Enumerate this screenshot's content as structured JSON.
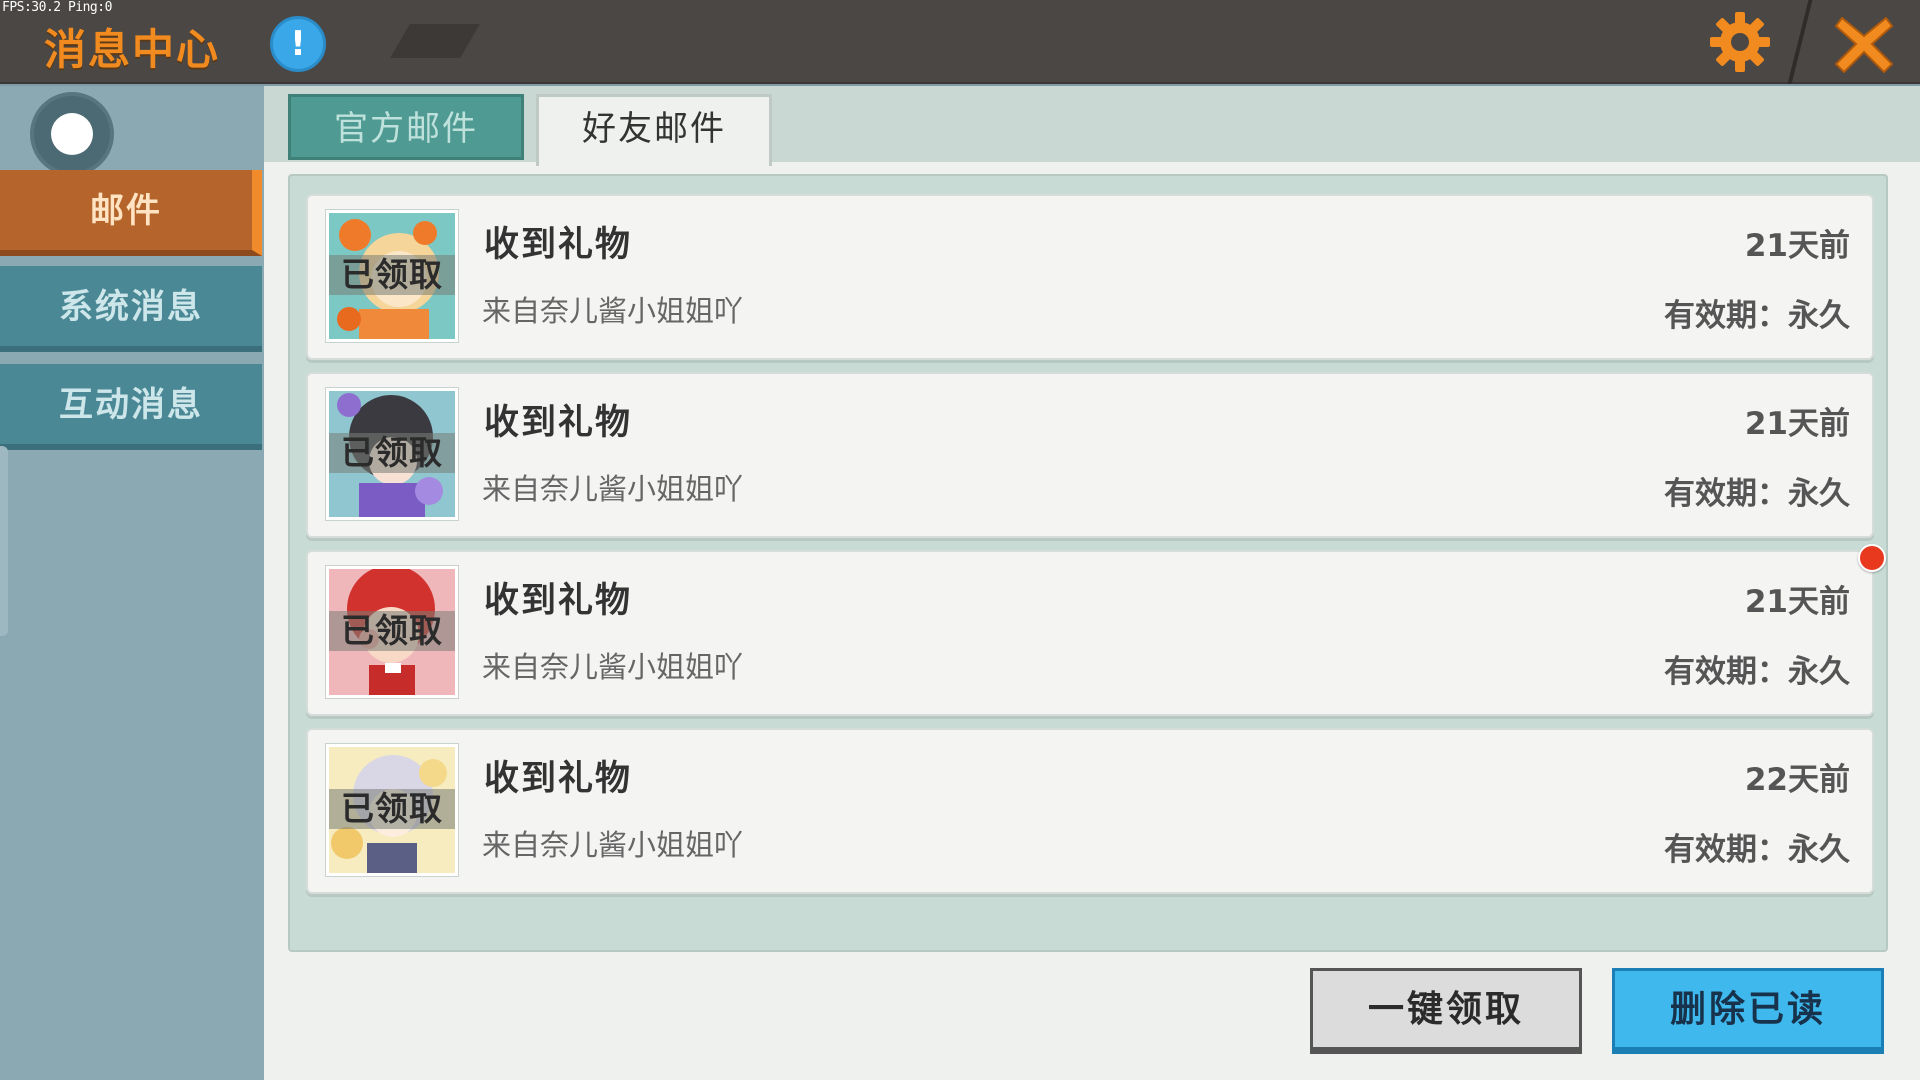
{
  "debug": {
    "fps_text": "FPS:30.2  Ping:0"
  },
  "header": {
    "title": "消息中心",
    "info_icon": "exclamation-icon",
    "info_symbol": "!",
    "settings_icon": "gear-icon",
    "close_icon": "close-x-icon"
  },
  "sidebar": {
    "items": [
      {
        "label": "邮件",
        "active": true
      },
      {
        "label": "系统消息",
        "active": false
      },
      {
        "label": "互动消息",
        "active": false
      }
    ]
  },
  "tabs": [
    {
      "label": "官方邮件",
      "active": false
    },
    {
      "label": "好友邮件",
      "active": true
    }
  ],
  "mails": [
    {
      "title": "收到礼物",
      "sender": "来自奈儿酱小姐姐吖",
      "time": "21天前",
      "validity": "有效期：永久",
      "status": "已领取"
    },
    {
      "title": "收到礼物",
      "sender": "来自奈儿酱小姐姐吖",
      "time": "21天前",
      "validity": "有效期：永久",
      "status": "已领取"
    },
    {
      "title": "收到礼物",
      "sender": "来自奈儿酱小姐姐吖",
      "time": "21天前",
      "validity": "有效期：永久",
      "status": "已领取"
    },
    {
      "title": "收到礼物",
      "sender": "来自奈儿酱小姐姐吖",
      "time": "22天前",
      "validity": "有效期：永久",
      "status": "已领取"
    }
  ],
  "buttons": {
    "claim_all": "一键领取",
    "delete_read": "删除已读"
  },
  "colors": {
    "accent_orange": "#f18a1f",
    "active_tab": "#b5652b",
    "sidebar_tab": "#4a8896",
    "delete_button": "#3fb8ee",
    "unread_dot": "#e8391f"
  }
}
